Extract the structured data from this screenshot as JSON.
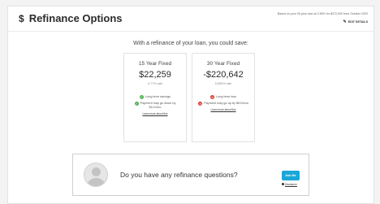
{
  "header": {
    "title": "Refinance Options",
    "dollar_icon": "$",
    "loan_info": "Based on your 30 year loan at 2.85% for $372,000 from October 2020",
    "edit_label": "EDIT DETAILS"
  },
  "headline": "With a refinance of your loan, you could save:",
  "options": [
    {
      "type": "15 Year Fixed",
      "amount": "$22,259",
      "rate": "4.77% rate",
      "term_text": "Long term savings",
      "term_status": "positive",
      "payment_text": "Payment may go down by $121/mo",
      "link": "Learn more about this"
    },
    {
      "type": "30 Year Fixed",
      "amount": "-$220,642",
      "rate": "5.655% rate",
      "term_text": "Long term loss",
      "term_status": "negative",
      "payment_text": "Payment may go up by $613/mo",
      "link": "Learn more about this"
    }
  ],
  "question_box": {
    "question": "Do you have any refinance questions?",
    "button_label": "Ask Me",
    "disclaimer": "Disclaimer"
  },
  "colors": {
    "positive": "#4caf50",
    "negative": "#e53935",
    "accent": "#18a7d8"
  }
}
